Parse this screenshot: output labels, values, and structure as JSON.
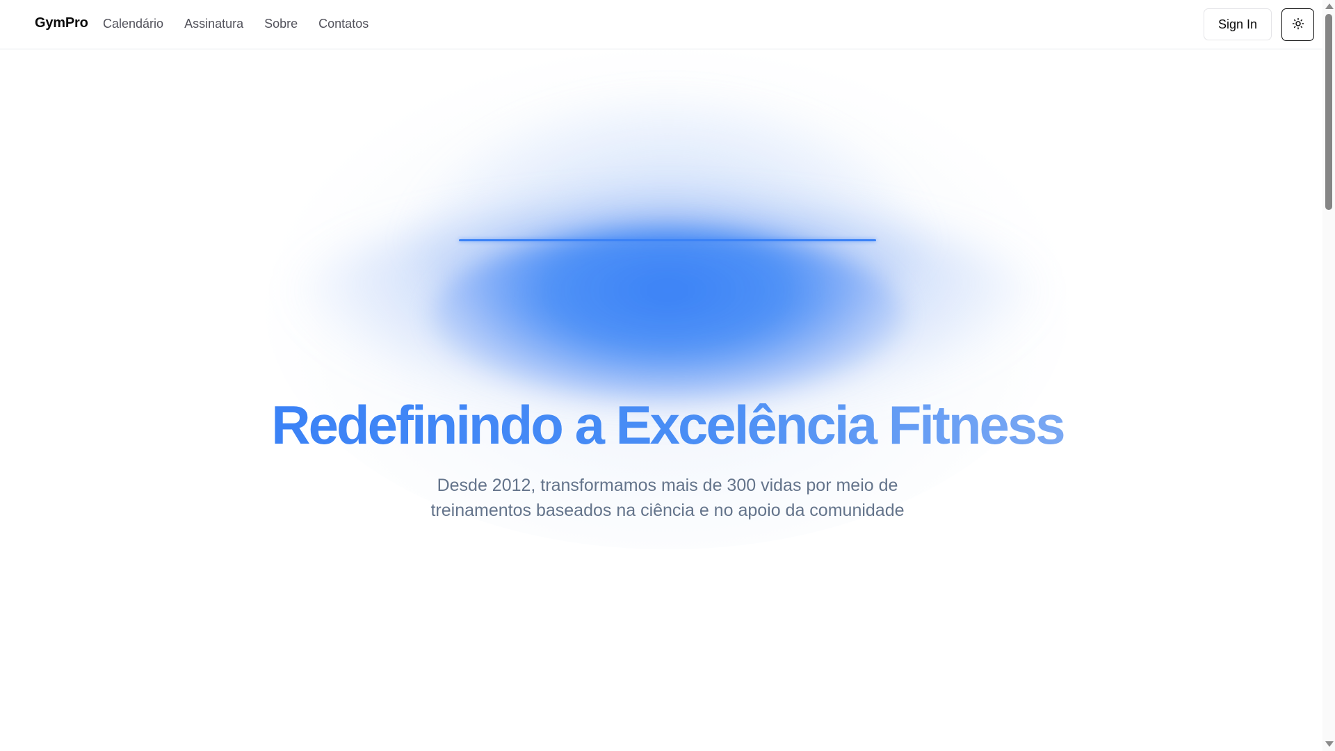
{
  "header": {
    "brand": "GymPro",
    "nav": [
      {
        "label": "Calendário"
      },
      {
        "label": "Assinatura"
      },
      {
        "label": "Sobre"
      },
      {
        "label": "Contatos"
      }
    ],
    "sign_in_label": "Sign In",
    "theme_toggle_icon": "sun-icon"
  },
  "hero": {
    "title": "Redefinindo a Excelência Fitness",
    "subtitle": "Desde 2012, transformamos mais de 300 vidas por meio de treinamentos baseados na ciência e no apoio da comunidade"
  },
  "colors": {
    "accent": "#3b82f6",
    "text_muted": "#64748b",
    "nav_text": "#52525b"
  }
}
